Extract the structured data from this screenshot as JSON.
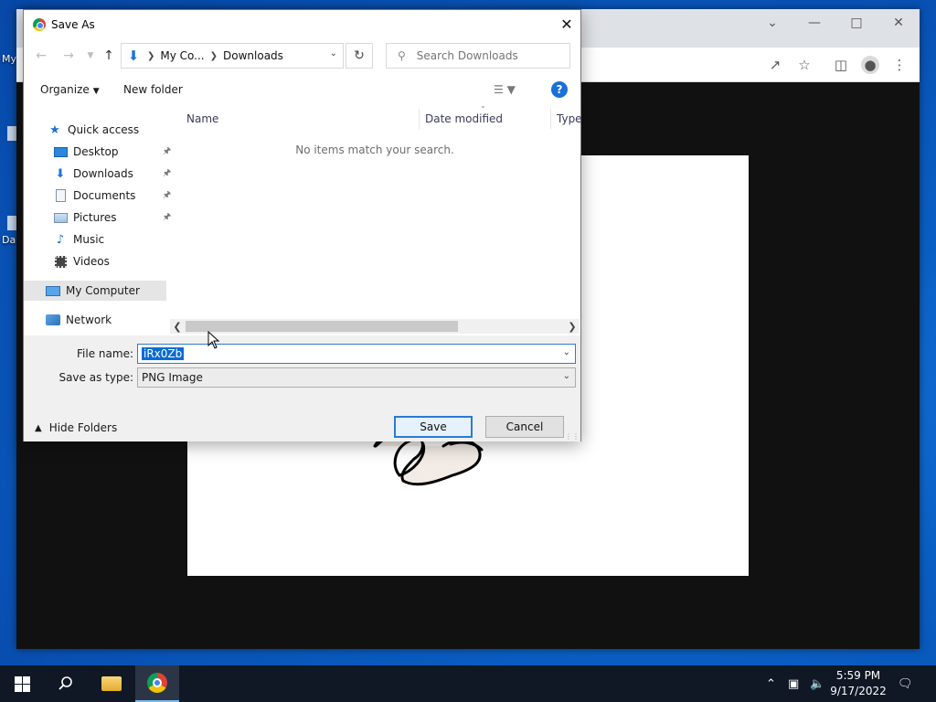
{
  "desktop": {
    "icon_label_1": "My",
    "icon_label_2": "Da"
  },
  "dialog": {
    "title": "Save As",
    "address": {
      "segments": [
        "My Co...",
        "Downloads"
      ]
    },
    "search": {
      "placeholder": "Search Downloads"
    },
    "commands": {
      "organize": "Organize",
      "new_folder": "New folder"
    },
    "nav": {
      "quick_access": "Quick access",
      "items": [
        "Desktop",
        "Downloads",
        "Documents",
        "Pictures",
        "Music",
        "Videos"
      ],
      "my_computer": "My Computer",
      "network": "Network"
    },
    "columns": {
      "name": "Name",
      "date_modified": "Date modified",
      "type": "Type"
    },
    "empty_message": "No items match your search.",
    "file_name_label": "File name:",
    "file_name_value": "iRx0Zb",
    "save_type_label": "Save as type:",
    "save_type_value": "PNG Image",
    "hide_folders": "Hide Folders",
    "save_button": "Save",
    "cancel_button": "Cancel"
  },
  "taskbar": {
    "time": "5:59 PM",
    "date": "9/17/2022"
  },
  "icons": {
    "start": "windows-logo-icon",
    "search": "search-icon",
    "explorer": "folder-icon",
    "chrome": "chrome-icon"
  },
  "colors": {
    "accent": "#0a6cd6",
    "taskbar": "#101826",
    "desktop": "#0a5fc4"
  }
}
